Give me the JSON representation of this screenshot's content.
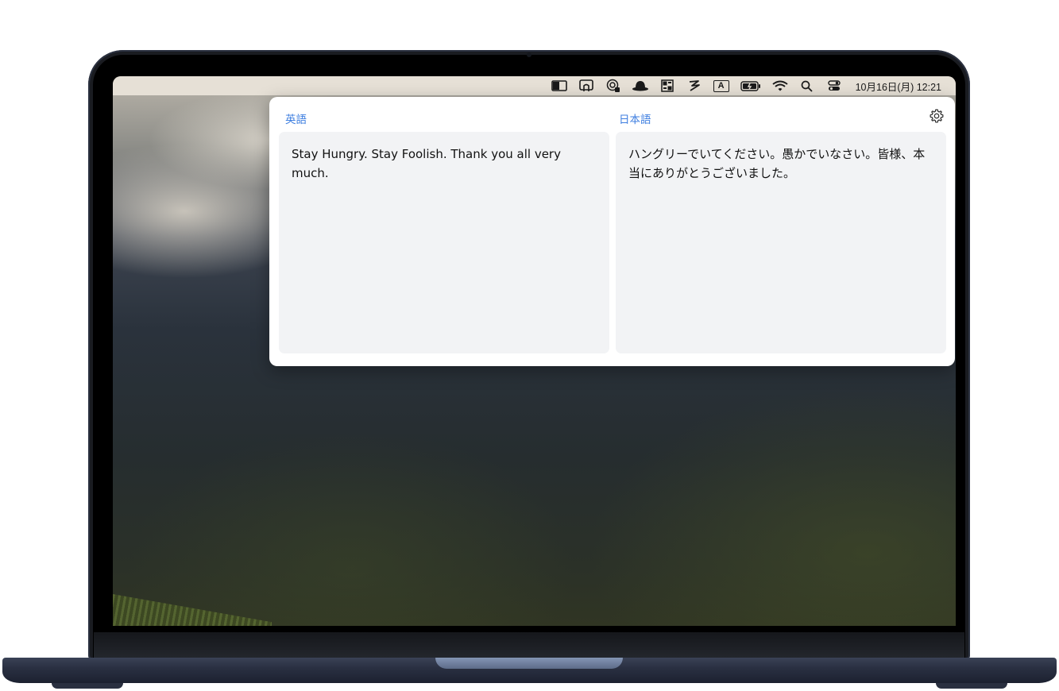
{
  "menubar": {
    "icons": [
      "sidebar-icon",
      "cast-icon",
      "touch-icon",
      "bowler-hat-icon",
      "grid-icon",
      "zap-icon",
      "input-source-icon",
      "battery-icon",
      "wifi-icon",
      "spotlight-search-icon",
      "control-center-icon"
    ],
    "input_source_letter": "A",
    "clock": "10月16日(月) 12:21"
  },
  "translator": {
    "source_language": "英語",
    "target_language": "日本語",
    "source_text": "Stay Hungry. Stay Foolish. Thank you all very much.",
    "translated_text": "ハングリーでいてください。愚かでいなさい。皆様、本当にありがとうございました。",
    "settings_icon": "gear-icon"
  },
  "colors": {
    "accent": "#3f7fe0",
    "pane_background": "#f2f3f5",
    "menubar_background": "#e6e0d6",
    "laptop_body": "#2a3042"
  }
}
